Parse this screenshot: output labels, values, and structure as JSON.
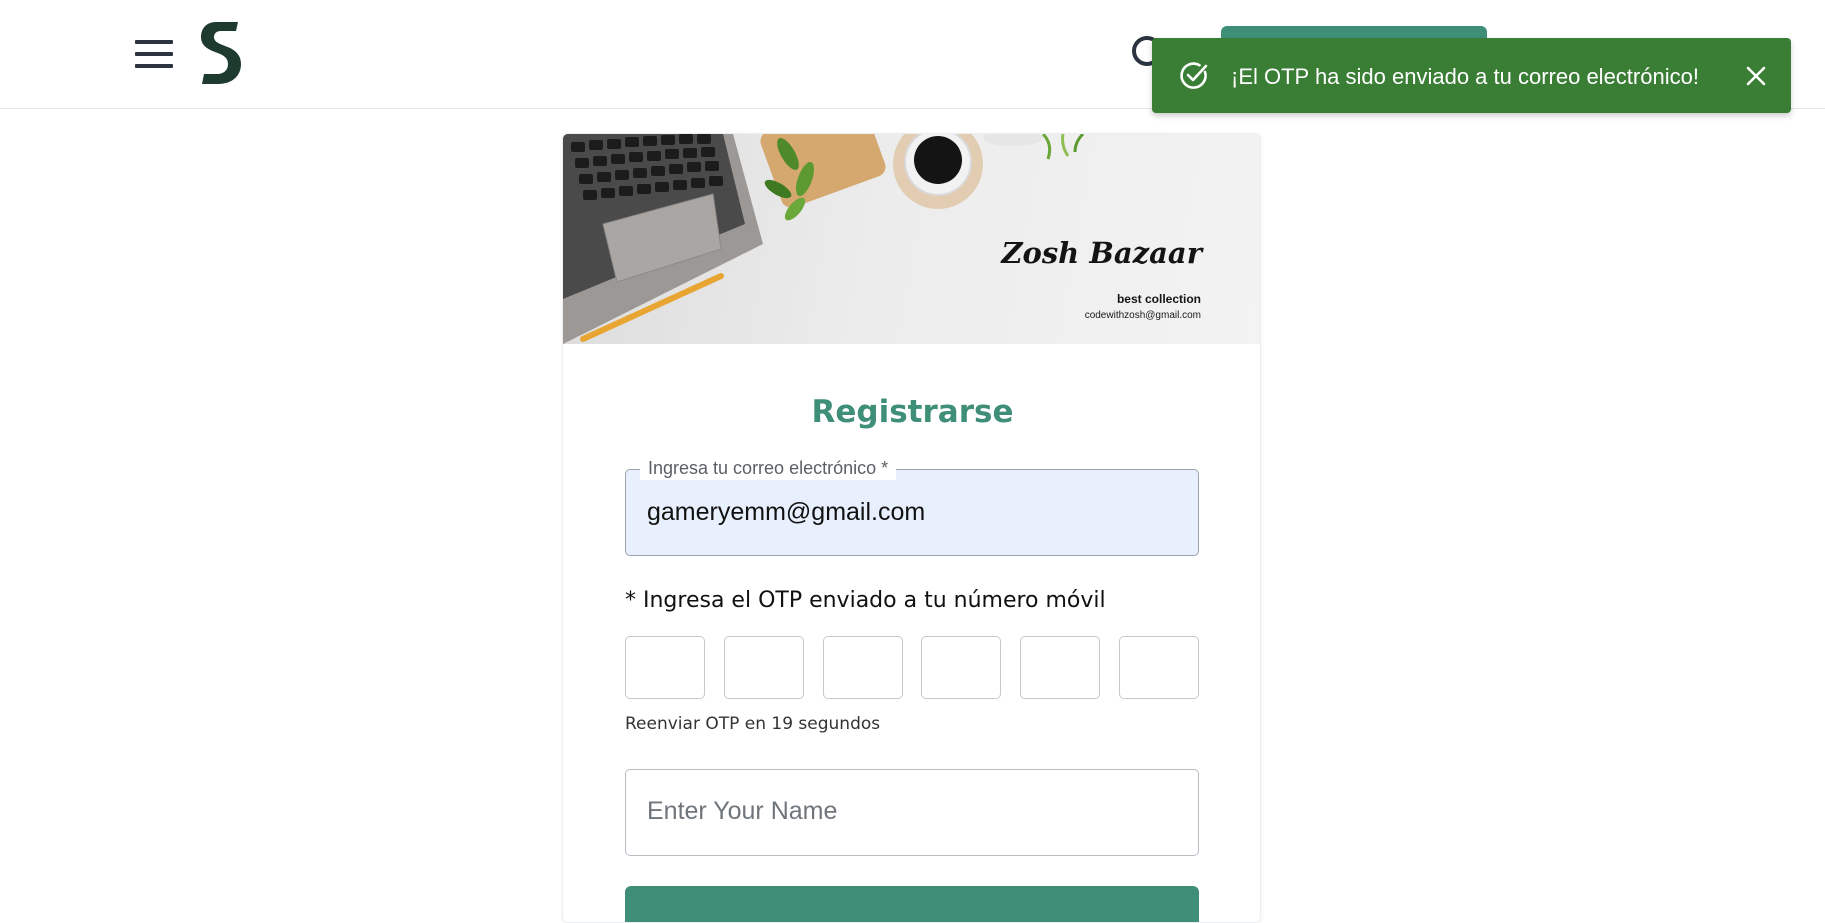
{
  "header": {
    "menu_icon": "hamburger-menu-icon",
    "logo_icon": "s-logo-icon",
    "search_icon": "search-icon",
    "accent_color": "#3f8f78"
  },
  "toast": {
    "message": "¡El OTP ha sido enviado a tu correo electrónico!",
    "icon": "check-circle-icon",
    "close_icon": "close-icon",
    "color": "#3a7d35"
  },
  "banner": {
    "brand_name": "Zosh Bazaar",
    "tagline": "best collection",
    "email": "codewithzosh@gmail.com"
  },
  "form": {
    "title": "Registrarse",
    "email_label": "Ingresa tu correo electrónico *",
    "email_value": "gameryemm@gmail.com",
    "otp_label": "* Ingresa el OTP enviado a tu número móvil",
    "otp_boxes": [
      "",
      "",
      "",
      "",
      "",
      ""
    ],
    "resend_text": "Reenviar OTP en 19 segundos",
    "name_placeholder": "Enter Your Name"
  }
}
